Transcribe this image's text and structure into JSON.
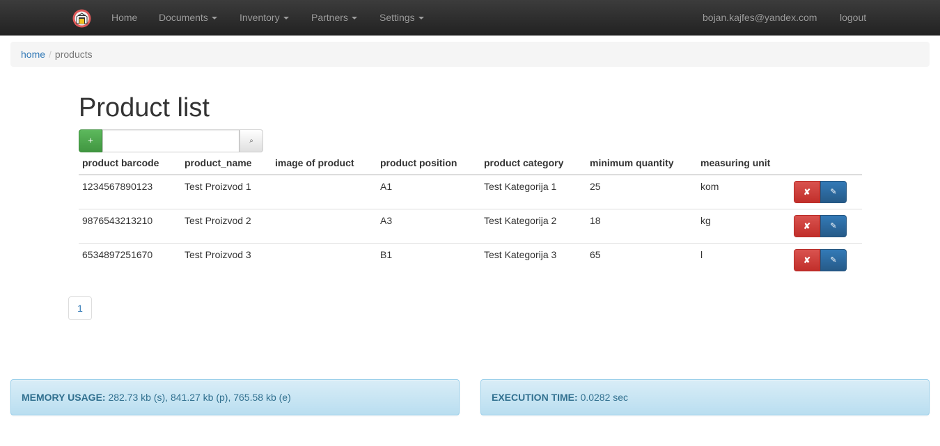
{
  "navbar": {
    "brand_icon": "warehouse-icon",
    "items": [
      {
        "label": "Home",
        "dropdown": false
      },
      {
        "label": "Documents",
        "dropdown": true
      },
      {
        "label": "Inventory",
        "dropdown": true
      },
      {
        "label": "Partners",
        "dropdown": true
      },
      {
        "label": "Settings",
        "dropdown": true
      }
    ],
    "user_email": "bojan.kajfes@yandex.com",
    "logout_label": "logout"
  },
  "breadcrumb": {
    "items": [
      "home",
      "products"
    ],
    "separator": "/"
  },
  "page": {
    "title": "Product list"
  },
  "toolbar": {
    "add_label": "+",
    "search_value": "",
    "search_placeholder": "",
    "search_icon_glyph": "⌕"
  },
  "table": {
    "headers": [
      "product barcode",
      "product_name",
      "image of product",
      "product position",
      "product category",
      "minimum quantity",
      "measuring unit",
      ""
    ],
    "rows": [
      {
        "barcode": "1234567890123",
        "name": "Test Proizvod 1",
        "image": "",
        "position": "A1",
        "category": "Test Kategorija 1",
        "min_qty": "25",
        "unit": "kom"
      },
      {
        "barcode": "9876543213210",
        "name": "Test Proizvod 2",
        "image": "",
        "position": "A3",
        "category": "Test Kategorija 2",
        "min_qty": "18",
        "unit": "kg"
      },
      {
        "barcode": "6534897251670",
        "name": "Test Proizvod 3",
        "image": "",
        "position": "B1",
        "category": "Test Kategorija 3",
        "min_qty": "65",
        "unit": "l"
      }
    ],
    "delete_glyph": "✘",
    "edit_glyph": "✎"
  },
  "pagination": {
    "pages": [
      "1"
    ],
    "current": "1"
  },
  "footer": {
    "memory_label": "MEMORY USAGE:",
    "memory_value": "282.73 kb (s), 841.27 kb (p), 765.58 kb (e)",
    "exec_label": "EXECUTION TIME:",
    "exec_value": "0.0282 sec"
  },
  "colors": {
    "navbar": "#222222",
    "link": "#337ab7",
    "success": "#5cb85c",
    "danger": "#d9534f",
    "primary": "#337ab7",
    "info_bg": "#d9edf7",
    "info_text": "#31708f"
  }
}
